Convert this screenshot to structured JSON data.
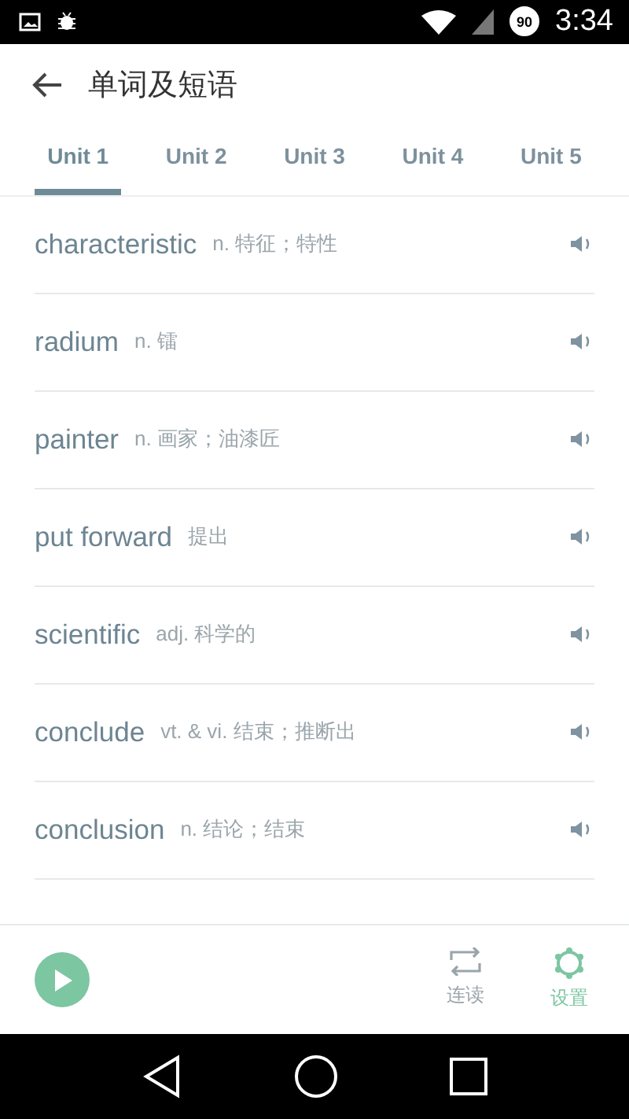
{
  "status_bar": {
    "battery": "90",
    "time": "3:34"
  },
  "header": {
    "title": "单词及短语"
  },
  "tabs": [
    {
      "label": "Unit 1",
      "selected": true
    },
    {
      "label": "Unit 2",
      "selected": false
    },
    {
      "label": "Unit 3",
      "selected": false
    },
    {
      "label": "Unit 4",
      "selected": false
    },
    {
      "label": "Unit 5",
      "selected": false
    }
  ],
  "words": [
    {
      "word": "characteristic",
      "meaning": "n. 特征；特性"
    },
    {
      "word": "radium",
      "meaning": "n. 镭"
    },
    {
      "word": "painter",
      "meaning": "n. 画家；油漆匠"
    },
    {
      "word": "put forward",
      "meaning": "提出"
    },
    {
      "word": "scientific",
      "meaning": "adj. 科学的"
    },
    {
      "word": "conclude",
      "meaning": "vt. & vi. 结束；推断出"
    },
    {
      "word": "conclusion",
      "meaning": "n. 结论；结束"
    }
  ],
  "bottom_bar": {
    "actions": [
      {
        "kind": "repeat",
        "label": "连读",
        "selected": false
      },
      {
        "kind": "settings",
        "label": "设置",
        "selected": true
      }
    ]
  }
}
